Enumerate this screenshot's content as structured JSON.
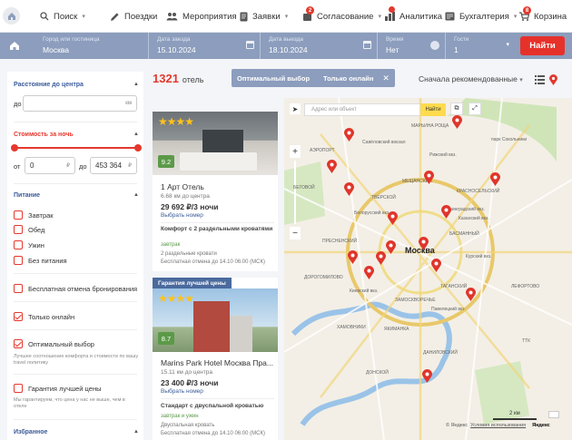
{
  "nav": {
    "search": "Поиск",
    "trips": "Поездки",
    "events": "Мероприятия",
    "requests": "Заявки",
    "approval": "Согласование",
    "approval_badge": "2",
    "analytics": "Аналитика",
    "accounting": "Бухгалтерия",
    "cart": "Корзина",
    "cart_badge": "8"
  },
  "search": {
    "city_label": "Город или гостиница",
    "city": "Москва",
    "checkin_label": "Дата заезда",
    "checkin": "15.10.2024",
    "checkout_label": "Дата выезда",
    "checkout": "18.10.2024",
    "time_label": "Время",
    "time": "Нет",
    "guests_label": "Гости",
    "guests": "1",
    "find": "Найти"
  },
  "filters": {
    "distance": "Расстояние до центра",
    "distance_to": "до",
    "distance_unit": "км",
    "price": "Стоимость за ночь",
    "price_from_label": "от",
    "price_from": "0",
    "price_to_label": "до",
    "price_to": "453 364",
    "currency": "₽",
    "food": "Питание",
    "food_items": [
      "Завтрак",
      "Обед",
      "Ужин",
      "Без питания"
    ],
    "free_cancel": "Бесплатная отмена бронирования",
    "online_only": "Только онлайн",
    "optimal": "Оптимальный выбор",
    "optimal_hint": "Лучшее соотношение комфорта и стоимости по вашу travel политику",
    "best_price": "Гарантия лучшей цены",
    "best_price_hint": "Мы гарантируем, что цена у нас не выше, чем в отеле",
    "favorites": "Избранное"
  },
  "results": {
    "count": "1321",
    "count_unit": "отель",
    "chip1": "Оптимальный выбор",
    "chip2": "Только онлайн",
    "sort": "Сначала рекомендованные"
  },
  "hotels": [
    {
      "score": "9.2",
      "name": "1 Арт Отель",
      "distance": "6.68 км до центра",
      "price": "29 692 ₽/3 ночи",
      "choose": "Выбрать номер",
      "room": "Комфорт с 2 раздельными кроватями",
      "meal": "завтрак",
      "beds": "2 раздельные кровати",
      "cancel": "Бесплатная отмена до 14.10 06:00 (МСК)"
    },
    {
      "tag": "Гарантия лучшей цены",
      "score": "8.7",
      "name": "Marins Park Hotel Москва Пра...",
      "distance": "15.11 км до центра",
      "price": "23 400 ₽/3 ночи",
      "choose": "Выбрать номер",
      "room": "Стандарт с двуспальной кроватью",
      "meal": "завтрак и ужин",
      "beds": "Двуспальная кровать",
      "cancel": "Бесплатная отмена до 14.10 06:00 (МСК)"
    }
  ],
  "map": {
    "placeholder": "Адрес или объект",
    "find": "Найти",
    "scale": "2 км",
    "copyright": "© Яндекс",
    "terms": "Условия использования",
    "brand": "Яндекс",
    "labels": {
      "city": "Москва",
      "sokolniki": "парк Сокольники",
      "savelovsky": "Савёловский вокзал",
      "rizhsky": "Рижский вкз.",
      "belorussky": "Белорусский вкз.",
      "leningradsky": "Ленинградский вкз.",
      "kazansky": "Казанский вкз.",
      "kursky": "Курский вкз.",
      "kievsky": "Киевский вкз.",
      "paveletsky": "Павелецкий вкз.",
      "zamoskvorechye": "ЗАМОСКВОРЕЧЬЕ",
      "danilovsky": "ДАНИЛОВСКИЙ",
      "meshchansky": "МЕЩАНСКИЙ",
      "presnensky": "ПРЕСНЕНСКИЙ",
      "khamovniki": "ХАМОВНИКИ",
      "yakimanka": "ЯКИМАНКА",
      "tverskoy": "ТВЕРСКОЙ",
      "krasnoselsky": "КРАСНОСЕЛЬСКИЙ",
      "basmanny": "БАСМАННЫЙ",
      "tagansky": "ТАГАНСКИЙ",
      "begovoy": "БЕГОВОЙ",
      "aeroport": "АЭРОПОРТ",
      "marfino": "МАРЬИНА РОЩА",
      "donskoy": "ДОНСКОЙ",
      "dorogomilovo": "ДОРОГОМИЛОВО",
      "lefortovo": "ЛЕФОРТОВО",
      "ttk": "ТТК"
    }
  },
  "colors": {
    "accent": "#e5382e",
    "searchbar": "#8c9dbd",
    "score": "#5b9a48",
    "star": "#ffc21a"
  }
}
